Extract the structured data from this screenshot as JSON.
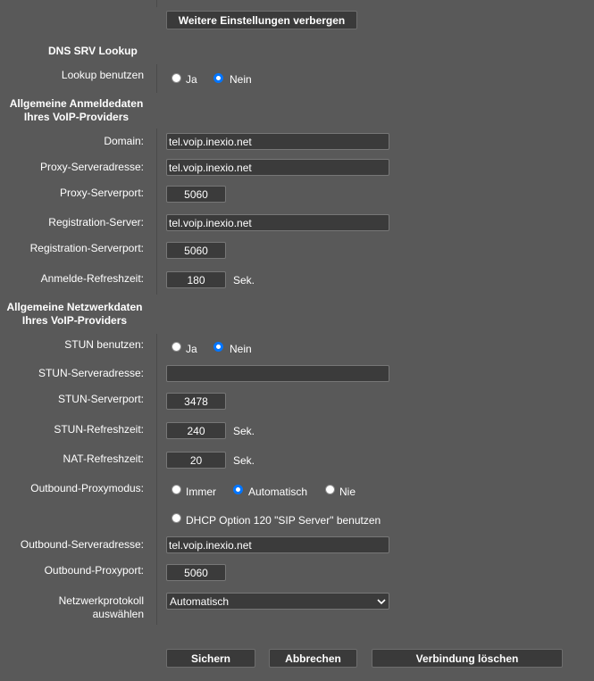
{
  "toggle_button": "Weitere Einstellungen verbergen",
  "dns": {
    "title": "DNS SRV Lookup",
    "lookup_label": "Lookup benutzen",
    "yes": "Ja",
    "no": "Nein",
    "selected": "Nein"
  },
  "login": {
    "title_line1": "Allgemeine Anmeldedaten",
    "title_line2": "Ihres VoIP-Providers",
    "domain_label": "Domain:",
    "domain_value": "tel.voip.inexio.net",
    "proxy_addr_label": "Proxy-Serveradresse:",
    "proxy_addr_value": "tel.voip.inexio.net",
    "proxy_port_label": "Proxy-Serverport:",
    "proxy_port_value": "5060",
    "reg_server_label": "Registration-Server:",
    "reg_server_value": "tel.voip.inexio.net",
    "reg_port_label": "Registration-Serverport:",
    "reg_port_value": "5060",
    "refresh_label": "Anmelde-Refreshzeit:",
    "refresh_value": "180",
    "refresh_unit": "Sek."
  },
  "network": {
    "title_line1": "Allgemeine Netzwerkdaten",
    "title_line2": "Ihres VoIP-Providers",
    "stun_use_label": "STUN benutzen:",
    "yes": "Ja",
    "no": "Nein",
    "stun_selected": "Nein",
    "stun_addr_label": "STUN-Serveradresse:",
    "stun_addr_value": "",
    "stun_port_label": "STUN-Serverport:",
    "stun_port_value": "3478",
    "stun_refresh_label": "STUN-Refreshzeit:",
    "stun_refresh_value": "240",
    "nat_refresh_label": "NAT-Refreshzeit:",
    "nat_refresh_value": "20",
    "unit": "Sek.",
    "outbound_mode_label": "Outbound-Proxymodus:",
    "mode_always": "Immer",
    "mode_auto": "Automatisch",
    "mode_never": "Nie",
    "mode_selected": "Automatisch",
    "dhcp_option": "DHCP Option 120 \"SIP Server\" benutzen",
    "outbound_addr_label": "Outbound-Serveradresse:",
    "outbound_addr_value": "tel.voip.inexio.net",
    "outbound_port_label": "Outbound-Proxyport:",
    "outbound_port_value": "5060",
    "protocol_label_line1": "Netzwerkprotokoll",
    "protocol_label_line2": "auswählen",
    "protocol_value": "Automatisch"
  },
  "footer": {
    "save": "Sichern",
    "cancel": "Abbrechen",
    "delete": "Verbindung löschen"
  },
  "icons": {
    "select_arrow": "chevron-down-icon"
  }
}
